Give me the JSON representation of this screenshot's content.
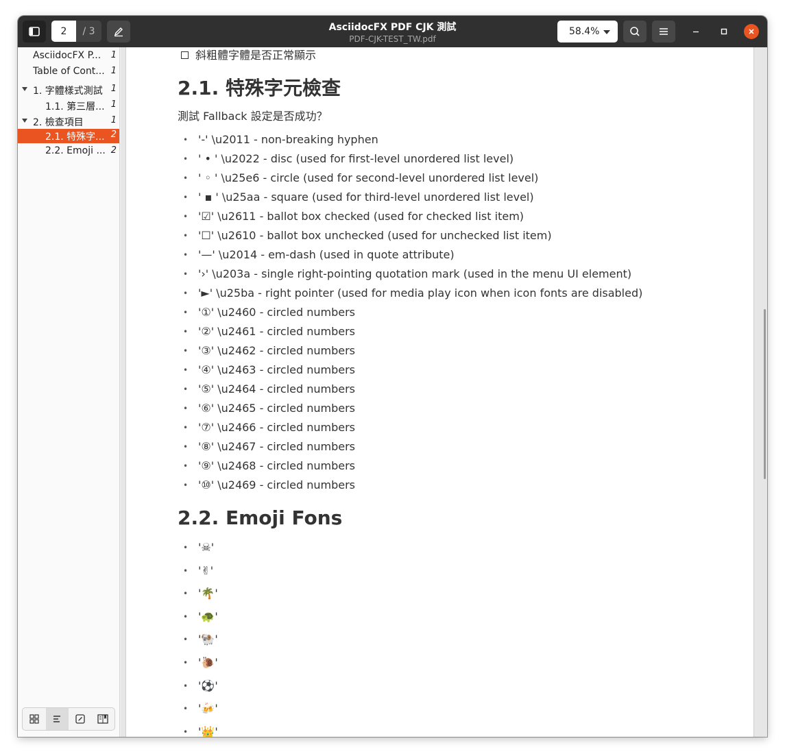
{
  "header": {
    "title": "AsciidocFX PDF CJK 測試",
    "subtitle": "PDF-CJK-TEST_TW.pdf",
    "current_page": "2",
    "total_pages": "/ 3",
    "zoom": "58.4%",
    "icons": [
      "sidebar-toggle-icon",
      "annotate-icon",
      "search-icon",
      "menu-icon",
      "minimize-icon",
      "maximize-icon",
      "close-icon"
    ]
  },
  "sidebar": {
    "items": [
      {
        "label": "AsciidocFX P...",
        "page": "1"
      },
      {
        "label": "Table of Cont...",
        "page": "1"
      },
      {
        "label": "1. 字體樣式測試",
        "page": "1"
      },
      {
        "label": "1.1. 第三層...",
        "page": "1"
      },
      {
        "label": "2. 檢查項目",
        "page": "1"
      },
      {
        "label": "2.1. 特殊字...",
        "page": "2"
      },
      {
        "label": "2.2. Emoji ...",
        "page": "2"
      }
    ],
    "tabs": [
      "thumbnails-icon",
      "outline-icon",
      "annotations-icon",
      "bookmarks-icon"
    ]
  },
  "document": {
    "top_checklist_item": "斜粗體字體是否正常顯示",
    "section_special": "2.1. 特殊字元檢查",
    "intro": "測試 Fallback 設定是否成功？",
    "special_items": [
      "'‑' \\u2011 - non-breaking hyphen",
      "' • ' \\u2022 - disc (used for first-level unordered list level)",
      "' ◦ ' \\u25e6 - circle (used for second-level unordered list level)",
      "' ▪ ' \\u25aa - square (used for third-level unordered list level)",
      "'☑' \\u2611 - ballot box checked (used for checked list item)",
      "'☐' \\u2610 - ballot box unchecked (used for unchecked list item)",
      "'—' \\u2014 - em-dash (used in quote attribute)",
      "'›' \\u203a - single right-pointing quotation mark (used in the menu UI element)",
      "'►' \\u25ba - right pointer (used for media play icon when icon fonts are disabled)",
      "'①' \\u2460 - circled numbers",
      "'②' \\u2461 - circled numbers",
      "'③' \\u2462 - circled numbers",
      "'④' \\u2463 - circled numbers",
      "'⑤' \\u2464 - circled numbers",
      "'⑥' \\u2465 - circled numbers",
      "'⑦' \\u2466 - circled numbers",
      "'⑧' \\u2467 - circled numbers",
      "'⑨' \\u2468 - circled numbers",
      "'⑩' \\u2469 - circled numbers"
    ],
    "section_emoji": "2.2. Emoji Fons",
    "emoji_items": [
      "'☠'",
      "'✌'",
      "'🌴'",
      "'🐢'",
      "'🐏'",
      "'🐌'",
      "'⚽'",
      "'🍻'",
      "'👑'"
    ]
  },
  "colors": {
    "accent": "#e95420",
    "headerbar": "#303030"
  }
}
